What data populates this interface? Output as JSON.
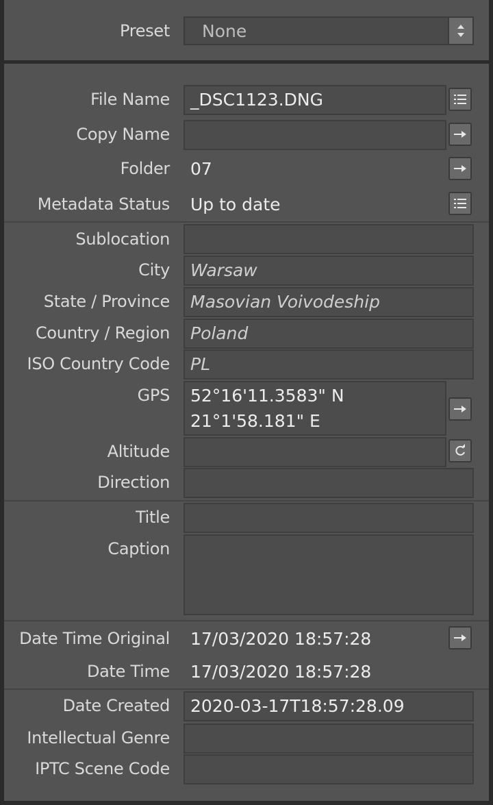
{
  "preset": {
    "label": "Preset",
    "value": "None"
  },
  "file": {
    "file_name_label": "File Name",
    "file_name": "_DSC1123.DNG",
    "copy_name_label": "Copy Name",
    "copy_name": "",
    "folder_label": "Folder",
    "folder": "07",
    "metadata_status_label": "Metadata Status",
    "metadata_status": "Up to date"
  },
  "location": {
    "sublocation_label": "Sublocation",
    "sublocation": "",
    "city_label": "City",
    "city": "Warsaw",
    "state_label": "State / Province",
    "state": "Masovian Voivodeship",
    "country_label": "Country / Region",
    "country": "Poland",
    "iso_label": "ISO Country Code",
    "iso": "PL",
    "gps_label": "GPS",
    "gps_lat": "52°16'11.3583\" N",
    "gps_lon": "21°1'58.181\" E",
    "altitude_label": "Altitude",
    "altitude": "",
    "direction_label": "Direction",
    "direction": ""
  },
  "descriptive": {
    "title_label": "Title",
    "title": "",
    "caption_label": "Caption",
    "caption": ""
  },
  "dates": {
    "dto_label": "Date Time Original",
    "dto": "17/03/2020 18:57:28",
    "dt_label": "Date Time",
    "dt": "17/03/2020 18:57:28",
    "created_label": "Date Created",
    "created": "2020-03-17T18:57:28.09",
    "genre_label": "Intellectual Genre",
    "genre": "",
    "scene_label": "IPTC Scene Code",
    "scene": ""
  },
  "icons": {
    "list": "list-icon",
    "arrow": "arrow-right-icon",
    "refresh": "refresh-icon",
    "stepper": "up-down-stepper-icon"
  }
}
